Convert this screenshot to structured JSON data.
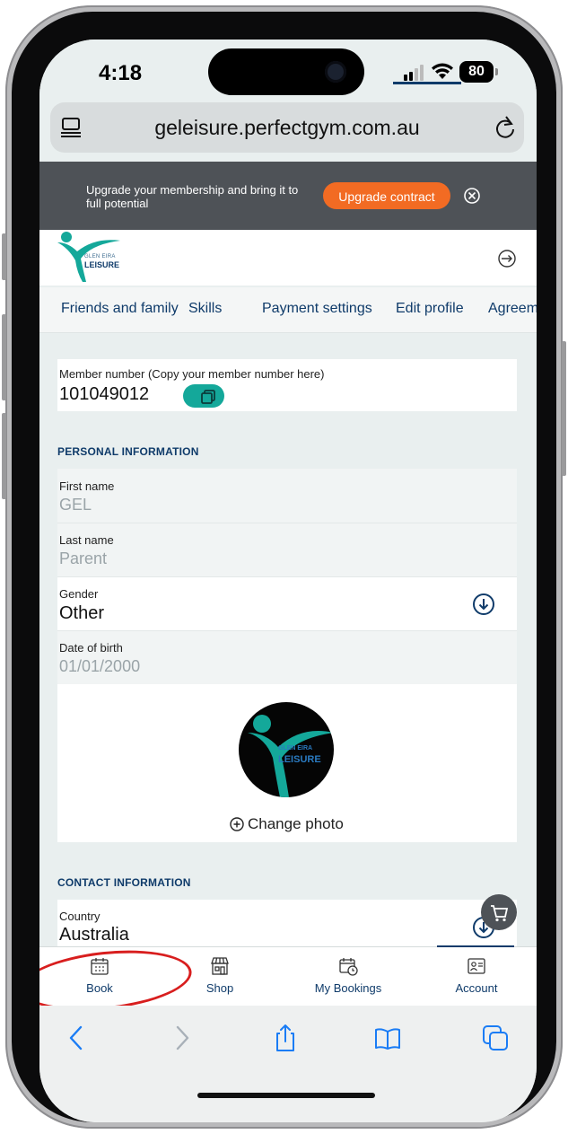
{
  "status_bar": {
    "time": "4:18",
    "battery": "80"
  },
  "browser": {
    "url": "geleisure.perfectgym.com.au"
  },
  "banner": {
    "text": "Upgrade your membership and bring it to full potential",
    "button_label": "Upgrade contract"
  },
  "brand": {
    "logo_top": "GLEN EIRA",
    "logo_bottom": "LEISURE"
  },
  "tabs": [
    {
      "label": "Friends and family"
    },
    {
      "label": "Skills"
    },
    {
      "label": "Payment settings"
    },
    {
      "label": "Edit profile",
      "active": true
    },
    {
      "label": "Agreem"
    }
  ],
  "member": {
    "label": "Member number (Copy your member number here)",
    "value": "101049012"
  },
  "personal": {
    "title": "PERSONAL INFORMATION",
    "first_name_label": "First name",
    "first_name": "GEL",
    "last_name_label": "Last name",
    "last_name": "Parent",
    "gender_label": "Gender",
    "gender": "Other",
    "dob_label": "Date of birth",
    "dob": "01/01/2000",
    "change_photo": "Change photo",
    "avatar_text_top": "GLEN EIRA",
    "avatar_text_bottom": "LEISURE"
  },
  "contact": {
    "title": "CONTACT INFORMATION",
    "country_label": "Country",
    "country": "Australia"
  },
  "bottom_nav": [
    {
      "label": "Book",
      "icon": "calendar-grid-icon"
    },
    {
      "label": "Shop",
      "icon": "shop-icon"
    },
    {
      "label": "My Bookings",
      "icon": "calendar-clock-icon"
    },
    {
      "label": "Account",
      "icon": "id-card-icon",
      "active": true
    }
  ],
  "colors": {
    "navy": "#0f3b6a",
    "teal": "#14a89a",
    "orange": "#f26b23",
    "annotation_red": "#d81e1e"
  }
}
